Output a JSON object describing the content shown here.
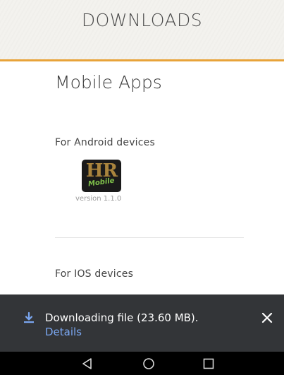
{
  "header": {
    "title": "DOWNLOADS"
  },
  "colors": {
    "accent": "#e8a33a",
    "link": "#7aa6f0",
    "snackbar": "#333538"
  },
  "main": {
    "section_title": "Mobile Apps",
    "android": {
      "label": "For Android devices",
      "app_icon": {
        "letters": "HR",
        "tagline": "Mobile"
      },
      "version": "version 1.1.0"
    },
    "ios": {
      "label": "For IOS devices"
    }
  },
  "download_notification": {
    "icon": "download-icon",
    "text": "Downloading file (23.60 MB).",
    "link": "Details",
    "close_icon": "close-icon"
  },
  "nav_bar": {
    "buttons": [
      "back-icon",
      "home-icon",
      "recents-icon"
    ]
  }
}
